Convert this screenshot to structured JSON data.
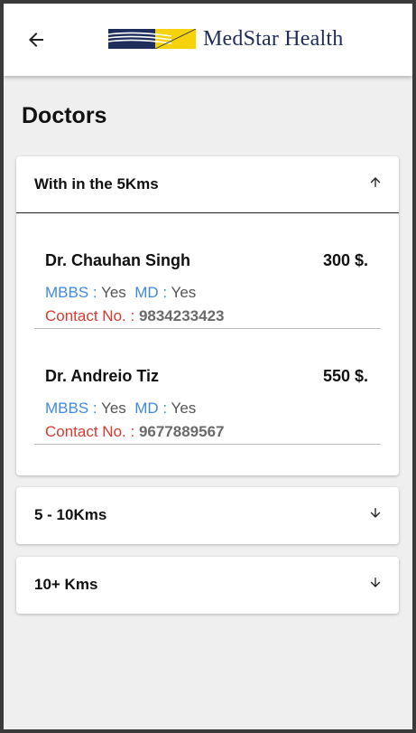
{
  "header": {
    "brand_name": "MedStar Health",
    "brand_colors": {
      "navy": "#1f2d5c",
      "yellow": "#f5d20a"
    }
  },
  "page": {
    "title": "Doctors"
  },
  "panels": [
    {
      "label": "With in the 5Kms",
      "expanded": true,
      "doctors": [
        {
          "name": "Dr. Chauhan Singh",
          "fee": "300 $.",
          "mbbs_label": "MBBS : ",
          "mbbs_value": "Yes",
          "md_label": "MD : ",
          "md_value": "Yes",
          "contact_label": "Contact No. : ",
          "contact_value": "9834233423"
        },
        {
          "name": "Dr. Andreio Tiz",
          "fee": "550 $.",
          "mbbs_label": "MBBS : ",
          "mbbs_value": "Yes",
          "md_label": "MD : ",
          "md_value": "Yes",
          "contact_label": "Contact No. : ",
          "contact_value": "9677889567"
        }
      ]
    },
    {
      "label": "5 - 10Kms",
      "expanded": false
    },
    {
      "label": "10+ Kms",
      "expanded": false
    }
  ],
  "colors": {
    "qualification_label": "#3f8ae0",
    "contact_label": "#d63a2f",
    "value_text": "#6a6a6a"
  }
}
